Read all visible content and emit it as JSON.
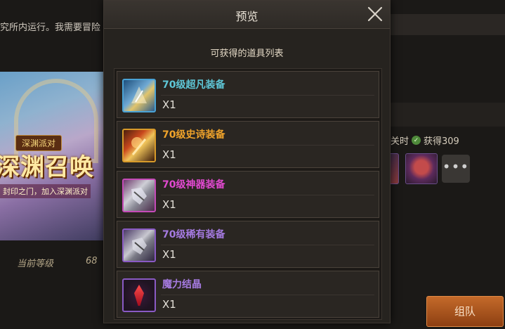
{
  "background": {
    "intro_text": "究所内运行。我需要冒险",
    "banner": {
      "tag": "深渊派对",
      "title": "深渊召唤",
      "subtitle": "封印之门，加入深渊派对"
    },
    "level_label": "当前等级",
    "level_value": "68",
    "stats_text_prefix": "关时",
    "stats_text_value": "获得309",
    "more_button": "•••",
    "team_button": "组队"
  },
  "modal": {
    "title": "预览",
    "close_icon": "close-icon",
    "subtitle": "可获得的道具列表",
    "items": [
      {
        "name": "70级超凡装备",
        "qty": "X1",
        "rarity": "super",
        "color": "#5ec6d6"
      },
      {
        "name": "70级史诗装备",
        "qty": "X1",
        "rarity": "epic",
        "color": "#f0a32a"
      },
      {
        "name": "70级神器装备",
        "qty": "X1",
        "rarity": "artifact",
        "color": "#e049cf"
      },
      {
        "name": "70级稀有装备",
        "qty": "X1",
        "rarity": "rare",
        "color": "#a57ae0"
      },
      {
        "name": "魔力结晶",
        "qty": "X1",
        "rarity": "crystal",
        "color": "#a57ae0"
      }
    ]
  }
}
